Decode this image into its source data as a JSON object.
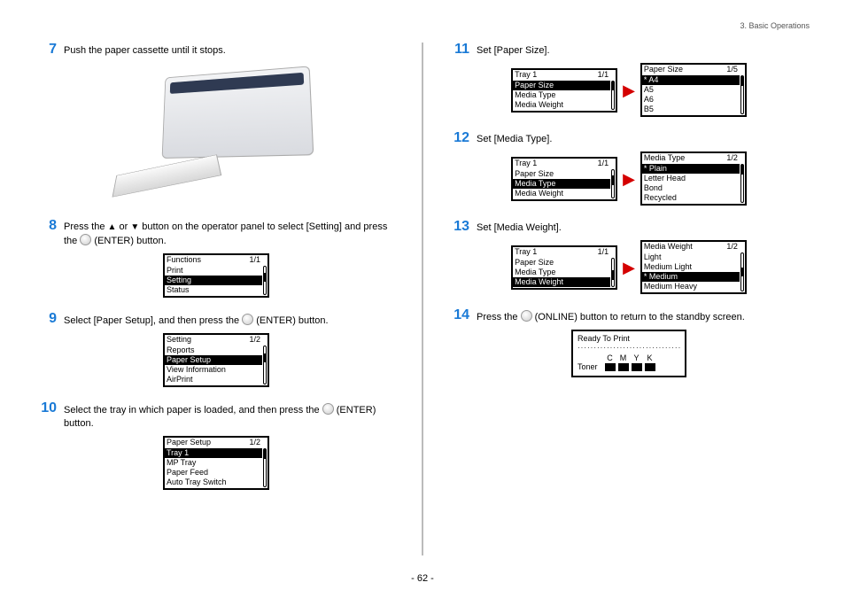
{
  "header": {
    "section": "3. Basic Operations"
  },
  "page_number": "- 62 -",
  "steps": {
    "s7": {
      "num": "7",
      "text_a": "Push the paper cassette until it stops."
    },
    "s8": {
      "num": "8",
      "text_a": "Press the ",
      "text_b": " or ",
      "text_c": " button on the operator panel to select [Setting] and press the ",
      "text_d": " (ENTER) button."
    },
    "s9": {
      "num": "9",
      "text_a": "Select [Paper Setup], and then press the ",
      "text_b": " (ENTER) button."
    },
    "s10": {
      "num": "10",
      "text_a": "Select the tray in which paper is loaded, and then press the ",
      "text_b": " (ENTER) button."
    },
    "s11": {
      "num": "11",
      "text_a": "Set [Paper Size]."
    },
    "s12": {
      "num": "12",
      "text_a": "Set [Media Type]."
    },
    "s13": {
      "num": "13",
      "text_a": "Set [Media Weight]."
    },
    "s14": {
      "num": "14",
      "text_a": "Press the ",
      "text_b": " (ONLINE) button to return to the standby screen."
    }
  },
  "screens": {
    "functions": {
      "title": "Functions",
      "page": "1/1",
      "items": [
        "Print",
        "Setting",
        "Status"
      ],
      "selected": "Setting"
    },
    "setting": {
      "title": "Setting",
      "page": "1/2",
      "items": [
        "Reports",
        "Paper Setup",
        "View Information",
        "AirPrint"
      ],
      "selected": "Paper Setup"
    },
    "paper_setup": {
      "title": "Paper Setup",
      "page": "1/2",
      "items": [
        "Tray 1",
        "MP Tray",
        "Paper Feed",
        "Auto Tray Switch"
      ],
      "selected": "Tray 1"
    },
    "tray1_ps": {
      "title": "Tray 1",
      "page": "1/1",
      "items": [
        "Paper Size",
        "Media Type",
        "Media Weight"
      ],
      "selected": "Paper Size"
    },
    "tray1_mt": {
      "title": "Tray 1",
      "page": "1/1",
      "items": [
        "Paper Size",
        "Media Type",
        "Media Weight"
      ],
      "selected": "Media Type"
    },
    "tray1_mw": {
      "title": "Tray 1",
      "page": "1/1",
      "items": [
        "Paper Size",
        "Media Type",
        "Media Weight"
      ],
      "selected": "Media Weight"
    },
    "paper_size": {
      "title": "Paper Size",
      "page": "1/5",
      "items": [
        "* A4",
        "A5",
        "A6",
        "B5"
      ],
      "selected": "* A4"
    },
    "media_type": {
      "title": "Media Type",
      "page": "1/2",
      "items": [
        "* Plain",
        "Letter Head",
        "Bond",
        "Recycled"
      ],
      "selected": "* Plain"
    },
    "media_weight": {
      "title": "Media Weight",
      "page": "1/2",
      "items": [
        "Light",
        "Medium Light",
        "* Medium",
        "Medium Heavy"
      ],
      "selected": "* Medium"
    }
  },
  "status": {
    "ready": "Ready To Print",
    "toner_label": "Toner",
    "toner_letters": [
      "C",
      "M",
      "Y",
      "K"
    ]
  }
}
